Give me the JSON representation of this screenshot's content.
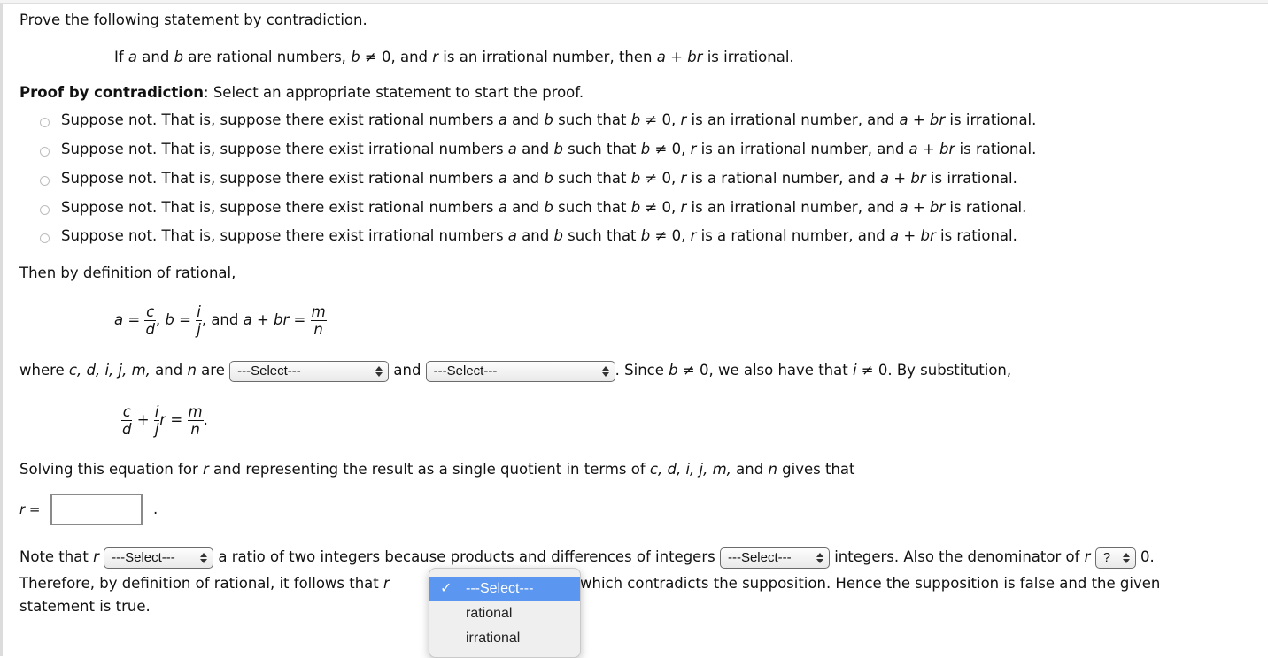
{
  "prompt": "Prove the following statement by contradiction.",
  "statement": {
    "p1": "If ",
    "a": "a",
    "p2": " and ",
    "b": "b",
    "p3": " are rational numbers, ",
    "b2": "b",
    "p4": " ≠ 0, and ",
    "r": "r",
    "p5": " is an irrational number, then ",
    "expr": "a",
    "p6": " + ",
    "expr2": "br",
    "p7": " is irrational."
  },
  "proof_heading": {
    "bold": "Proof by contradiction",
    "rest": ": Select an appropriate statement to start the proof."
  },
  "options": [
    {
      "kind1": "rational",
      "rkind": "an irrational",
      "sumkind": "irrational"
    },
    {
      "kind1": "irrational",
      "rkind": "an irrational",
      "sumkind": "rational"
    },
    {
      "kind1": "rational",
      "rkind": "a rational",
      "sumkind": "irrational"
    },
    {
      "kind1": "rational",
      "rkind": "an irrational",
      "sumkind": "rational"
    },
    {
      "kind1": "irrational",
      "rkind": "a rational",
      "sumkind": "rational"
    }
  ],
  "option_text": {
    "start": "Suppose not. That is, suppose there exist ",
    "numbers": " numbers ",
    "and": " and ",
    "such": " such that ",
    "neq": " ≠ 0, ",
    "is": " is ",
    "number_and": " number, and ",
    "plus": " + ",
    "is2": " is ",
    "end": "."
  },
  "def_line": "Then by definition of rational,",
  "eq1": {
    "a_eq": "a =",
    "c": "c",
    "d": "d",
    "b_eq": "b =",
    "i": "i",
    "j": "j",
    "and": "and",
    "sum": "a + br =",
    "m": "m",
    "n": "n"
  },
  "where_line": {
    "lead": "where ",
    "vars": "c, d, i, j, m,",
    "and_n": " and ",
    "n": "n",
    "are": " are",
    "select1": "---Select---",
    "and2": "and",
    "select2": "---Select---",
    "since": ". Since ",
    "b": "b",
    "neq1": " ≠ 0, we also have that ",
    "i": "i",
    "neq2": " ≠ 0. By substitution,"
  },
  "eq2": {
    "c": "c",
    "d": "d",
    "plus": "+",
    "i": "i",
    "j": "j",
    "r_eq": "r =",
    "m": "m",
    "n": "n",
    "period": "."
  },
  "solving_line": {
    "p1": "Solving this equation for ",
    "r": "r",
    "p2": " and representing the result as a single quotient in terms of ",
    "vars": "c, d, i, j, m,",
    "p3": " and ",
    "n": "n",
    "p4": " gives that"
  },
  "answer": {
    "label": "r =",
    "value": "",
    "period": "."
  },
  "note_line": {
    "p1": "Note that ",
    "r": "r",
    "select1": "---Select---",
    "p2": "a ratio of two integers because products and differences of integers",
    "select2": "---Select---",
    "p3": "integers. Also the denominator of ",
    "r2": "r",
    "select3": "?",
    "p4": "0."
  },
  "therefore_line": {
    "p1": "Therefore, by definition of rational, it follows that ",
    "r": "r",
    "p2": "which contradicts the supposition. Hence the supposition is false and the given",
    "p3": "statement is true."
  },
  "dropdown": {
    "check": "✓",
    "items": [
      "---Select---",
      "rational",
      "irrational"
    ],
    "selected_index": 0
  },
  "colors": {
    "highlight": "#5b96f0",
    "text": "#111111",
    "border": "#dcdcdc"
  }
}
